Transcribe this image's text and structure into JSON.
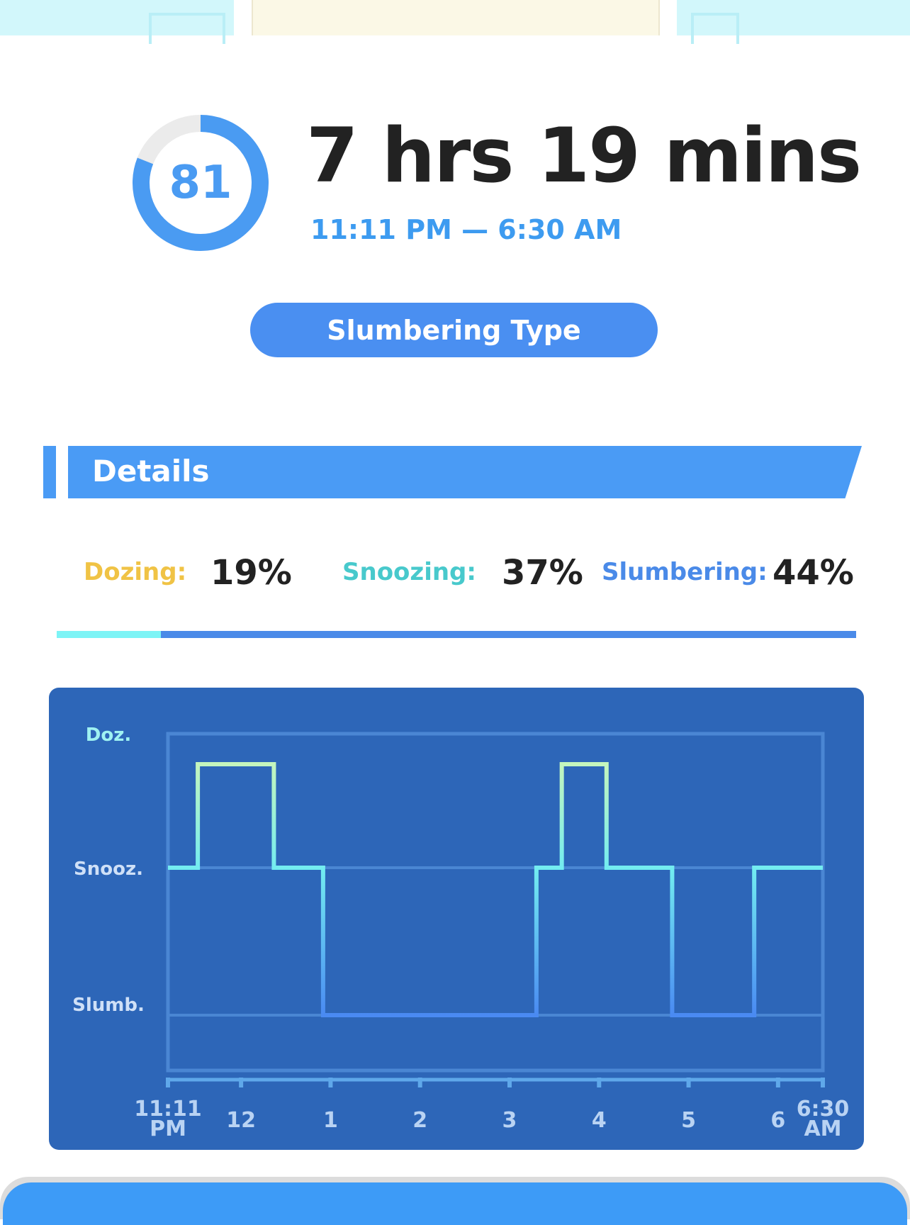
{
  "score": {
    "value": "81",
    "fraction": 0.81,
    "ring_color": "#4a9bf2",
    "track_color": "#ebebeb"
  },
  "duration": "7 hrs 19 mins",
  "time_range": "11:11 PM — 6:30 AM",
  "sleep_type_button": "Slumbering Type",
  "details": {
    "title": "Details",
    "stats": [
      {
        "label": "Dozing:",
        "value": "19%",
        "color": "#f0c345"
      },
      {
        "label": "Snoozing:",
        "value": "37%",
        "color": "#48c9cc"
      },
      {
        "label": "Slumbering:",
        "value": "44%",
        "color": "#4a8ae8"
      }
    ],
    "ratio_bar": [
      {
        "name": "snoozing",
        "fraction": 0.13,
        "color": "#7df4f6"
      },
      {
        "name": "slumbering",
        "fraction": 0.87,
        "color": "#4a8ae8"
      }
    ]
  },
  "chart_data": {
    "type": "line",
    "step": true,
    "y_levels": [
      "Doz.",
      "Snooz.",
      "Slumb."
    ],
    "x_ticks": [
      {
        "t": 0,
        "label": [
          "11:11",
          "PM"
        ]
      },
      {
        "t": 49,
        "label": [
          "12"
        ]
      },
      {
        "t": 109,
        "label": [
          "1"
        ]
      },
      {
        "t": 169,
        "label": [
          "2"
        ]
      },
      {
        "t": 229,
        "label": [
          "3"
        ]
      },
      {
        "t": 289,
        "label": [
          "4"
        ]
      },
      {
        "t": 349,
        "label": [
          "5"
        ]
      },
      {
        "t": 409,
        "label": [
          "6"
        ]
      },
      {
        "t": 439,
        "label": [
          "6:30",
          "AM"
        ]
      }
    ],
    "x_range_minutes": [
      0,
      439
    ],
    "segments": [
      {
        "start": 0,
        "end": 20,
        "level": 1
      },
      {
        "start": 20,
        "end": 71,
        "level": 0
      },
      {
        "start": 71,
        "end": 104,
        "level": 1
      },
      {
        "start": 104,
        "end": 247,
        "level": 2
      },
      {
        "start": 247,
        "end": 264,
        "level": 1
      },
      {
        "start": 264,
        "end": 294,
        "level": 0
      },
      {
        "start": 294,
        "end": 338,
        "level": 1
      },
      {
        "start": 338,
        "end": 393,
        "level": 2
      },
      {
        "start": 393,
        "end": 439,
        "level": 1
      }
    ],
    "level_colors": [
      "#c4f5bd",
      "#72ecf1",
      "#4a8af2"
    ],
    "colors": {
      "panel": "#2d66b8",
      "grid": "#4a86d3",
      "axis": "#5fa8ea",
      "y_label": "#cfe0f7",
      "y_label_doz": "#9ff2f2",
      "x_label": "#b9d3f3"
    }
  }
}
